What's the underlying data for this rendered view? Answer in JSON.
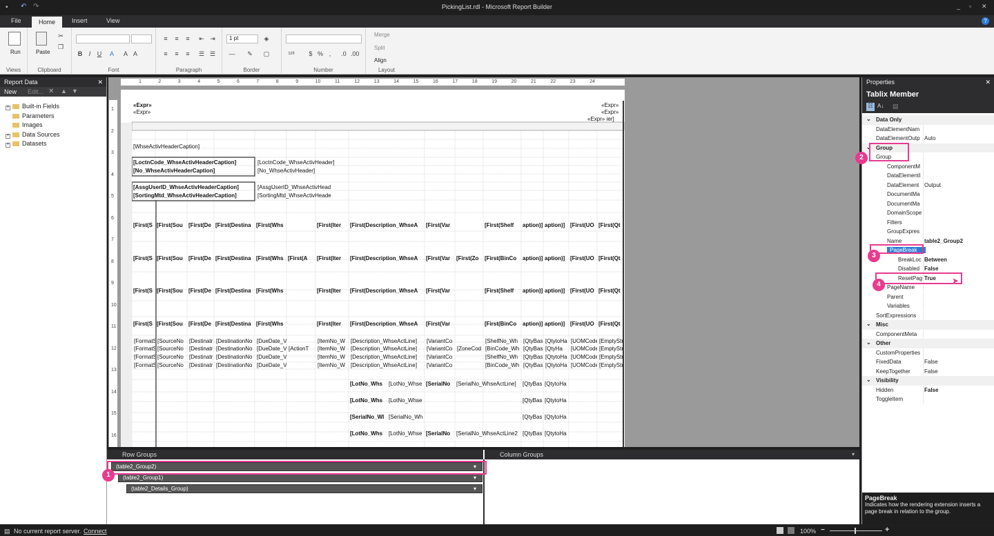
{
  "app": {
    "title": "PickingList.rdl - Microsoft Report Builder"
  },
  "menu": {
    "file": "File",
    "home": "Home",
    "insert": "Insert",
    "view": "View"
  },
  "ribbon": {
    "run": "Run",
    "paste": "Paste",
    "groups": {
      "views": "Views",
      "clipboard": "Clipboard",
      "font": "Font",
      "paragraph": "Paragraph",
      "border": "Border",
      "number": "Number",
      "layout": "Layout"
    },
    "border_size": "1 pt",
    "merge": "Merge",
    "split": "Split",
    "align": "Align"
  },
  "report_data": {
    "title": "Report Data",
    "new": "New",
    "edit": "Edit...",
    "items": [
      "Built-in Fields",
      "Parameters",
      "Images",
      "Data Sources",
      "Datasets"
    ]
  },
  "ruler": [
    "1",
    "2",
    "3",
    "4",
    "5",
    "6",
    "7",
    "8",
    "9",
    "10",
    "11",
    "12",
    "13",
    "14",
    "15",
    "16",
    "17",
    "18",
    "19",
    "20",
    "21",
    "22",
    "23",
    "24"
  ],
  "vruler": [
    "1",
    "2",
    "3",
    "4",
    "5",
    "6",
    "7",
    "8",
    "9",
    "10",
    "11",
    "12",
    "13",
    "14",
    "15",
    "16"
  ],
  "canvas": {
    "expr1": "«Expr»",
    "expr2": "«Expr»",
    "rexpr1": "«Expr»",
    "rexpr2": "«Expr»",
    "rexpr3": "«Expr» ier]",
    "caption": "[WhseActivHeaderCaption]",
    "loc1": "[LoctnCode_WhseActivHeaderCaption]",
    "loc2": "[LoctnCode_WhseActivHeader]",
    "no1": "[No_WhseActivHeaderCaption]",
    "no2": "[No_WhseActivHeader]",
    "assoc1": "[AssgUserID_WhseActivHeaderCaption]",
    "assoc2": "[AssgUserID_WhseActivHead",
    "sort1": "[SortingMtd_WhseActivHeaderCaption]",
    "sort2": "[SortingMtd_WhseActivHeade",
    "hdr_rows": [
      [
        "[First(S",
        "[First(Sou",
        "[First(De",
        "[First(Destina",
        "[First(Whs",
        "",
        "[First(Iter",
        "[First(Description_WhseA",
        "[First(Var",
        "",
        "[First(Shelf",
        "aption)]",
        "aption)]",
        "[First(UO",
        "[First(Qt"
      ],
      [
        "[First(S",
        "[First(Sou",
        "[First(De",
        "[First(Destina",
        "[First(Whs",
        "[First(A",
        "[First(Iter",
        "[First(Description_WhseA",
        "[First(Var",
        "[First(Zo",
        "[First(BinCo",
        "aption)]",
        "aption)]",
        "[First(UO",
        "[First(Qt"
      ],
      [
        "[First(S",
        "[First(Sou",
        "[First(De",
        "[First(Destina",
        "[First(Whs",
        "",
        "[First(Iter",
        "[First(Description_WhseA",
        "[First(Var",
        "",
        "[First(Shelf",
        "aption)]",
        "aption)]",
        "[First(UO",
        "[First(Qt"
      ],
      [
        "[First(S",
        "[First(Sou",
        "[First(De",
        "[First(Destina",
        "[First(Whs",
        "",
        "[First(Iter",
        "[First(Description_WhseA",
        "[First(Var",
        "",
        "[First(BinCo",
        "aption)]",
        "aption)]",
        "[First(UO",
        "[First(Qt"
      ]
    ],
    "detail_rows": [
      [
        "[FormatS",
        "[SourceNo",
        "[Destinatr",
        "[DestinationNo",
        "[DueDate_V",
        "",
        "[ItemNo_W",
        "[Description_WhseActLine]",
        "[VariantCo",
        "",
        "[ShelfNo_Wh",
        "[QtyBas",
        "[QtytoHa",
        "[UOMCode",
        "[EmptyStr"
      ],
      [
        "[FormatS",
        "[SourceNo",
        "[Destinatr",
        "[DestinationNo",
        "[DueDate_V",
        "[ActionT",
        "[ItemNo_W",
        "[Description_WhseActLine]",
        "[VariantCo",
        "[ZoneCod",
        "[BinCode_Wh",
        "[QtyBas",
        "[QtyHa",
        "[UOMCode",
        "[EmptyStr"
      ],
      [
        "[FormatS",
        "[SourceNo",
        "[Destinatr",
        "[DestinationNo",
        "[DueDate_V",
        "",
        "[ItemNo_W",
        "[Description_WhseActLine]",
        "[VariantCo",
        "",
        "[ShelfNo_Wh",
        "[QtyBas",
        "[QtytoHa",
        "[UOMCode",
        "[EmptyStr"
      ],
      [
        "[FormatS",
        "[SourceNo",
        "[Destinatr",
        "[DestinationNo",
        "[DueDate_V",
        "",
        "[ItemNo_W",
        "[Description_WhseActLine]",
        "[VariantCo",
        "",
        "[BinCode_Wh",
        "[QtyBas",
        "[QtytoHa",
        "[UOMCode",
        "[EmptyStr"
      ]
    ],
    "lot_rows": [
      [
        "[LotNo_Whs",
        "[LotNo_Whse",
        "[SerialNo",
        "[SerialNo_WhseActLine]",
        "[QtyBas",
        "[QtytoHa"
      ],
      [
        "[LotNo_Whs",
        "[LotNo_Whse",
        "",
        "",
        "[QtyBas",
        "[QtytoHa"
      ],
      [
        "[SerialNo_Wl",
        "[SerialNo_Wh",
        "",
        "",
        "[QtyBas",
        "[QtytoHa"
      ],
      [
        "[LotNo_Whs",
        "[LotNo_Whse",
        "[SerialNo",
        "[SerialNo_WhseActLine2",
        "[QtyBas",
        "[QtytoHa"
      ]
    ]
  },
  "row_groups": {
    "title": "Row Groups",
    "g1": "(table2_Group2)",
    "g2": "(table2_Group1)",
    "g3": "(table2_Details_Group)"
  },
  "column_groups": {
    "title": "Column Groups"
  },
  "properties": {
    "title": "Properties",
    "object": "Tablix Member",
    "rows": [
      {
        "n": "Data Only",
        "v": "",
        "sec": true,
        "ind": 0
      },
      {
        "n": "DataElementNam",
        "v": "",
        "ind": 1
      },
      {
        "n": "DataElementOutp",
        "v": "Auto",
        "ind": 1
      },
      {
        "n": "Group",
        "v": "",
        "sec": true,
        "ind": 0
      },
      {
        "n": "Group",
        "v": "",
        "ind": 1
      },
      {
        "n": "ComponentM",
        "v": "",
        "ind": 2
      },
      {
        "n": "DataElementI",
        "v": "",
        "ind": 2
      },
      {
        "n": "DataElement",
        "v": "Output",
        "ind": 2
      },
      {
        "n": "DocumentMa",
        "v": "",
        "ind": 2
      },
      {
        "n": "DocumentMa",
        "v": "",
        "ind": 2
      },
      {
        "n": "DomainScope",
        "v": "",
        "ind": 2
      },
      {
        "n": "Filters",
        "v": "",
        "ind": 2
      },
      {
        "n": "GroupExpres",
        "v": "",
        "ind": 2
      },
      {
        "n": "Name",
        "v": "table2_Group2",
        "ind": 2,
        "bold": true
      },
      {
        "n": "PageBreak",
        "v": "",
        "ind": 2,
        "sel": true
      },
      {
        "n": "BreakLoc",
        "v": "Between",
        "ind": 3,
        "bold": true
      },
      {
        "n": "Disabled",
        "v": "False",
        "ind": 3,
        "bold": true
      },
      {
        "n": "ResetPag",
        "v": "True",
        "ind": 3,
        "bold": true
      },
      {
        "n": "PageName",
        "v": "",
        "ind": 2
      },
      {
        "n": "Parent",
        "v": "",
        "ind": 2
      },
      {
        "n": "Variables",
        "v": "",
        "ind": 2
      },
      {
        "n": "SortExpressions",
        "v": "",
        "ind": 1
      },
      {
        "n": "Misc",
        "v": "",
        "sec": true,
        "ind": 0
      },
      {
        "n": "ComponentMeta",
        "v": "",
        "ind": 1
      },
      {
        "n": "Other",
        "v": "",
        "sec": true,
        "ind": 0
      },
      {
        "n": "CustomProperties",
        "v": "",
        "ind": 1
      },
      {
        "n": "FixedData",
        "v": "False",
        "ind": 1
      },
      {
        "n": "KeepTogether",
        "v": "False",
        "ind": 1
      },
      {
        "n": "Visibility",
        "v": "",
        "sec": true,
        "ind": 0
      },
      {
        "n": "Hidden",
        "v": "False",
        "ind": 1,
        "bold": true
      },
      {
        "n": "ToggleItem",
        "v": "",
        "ind": 1
      }
    ],
    "help_title": "PageBreak",
    "help_text": "Indicates how the rendering extension inserts a page break in relation to the group."
  },
  "callouts": [
    "1",
    "2",
    "3",
    "4"
  ],
  "status": {
    "text": "No current report server.",
    "link": "Connect",
    "zoom": "100%"
  }
}
